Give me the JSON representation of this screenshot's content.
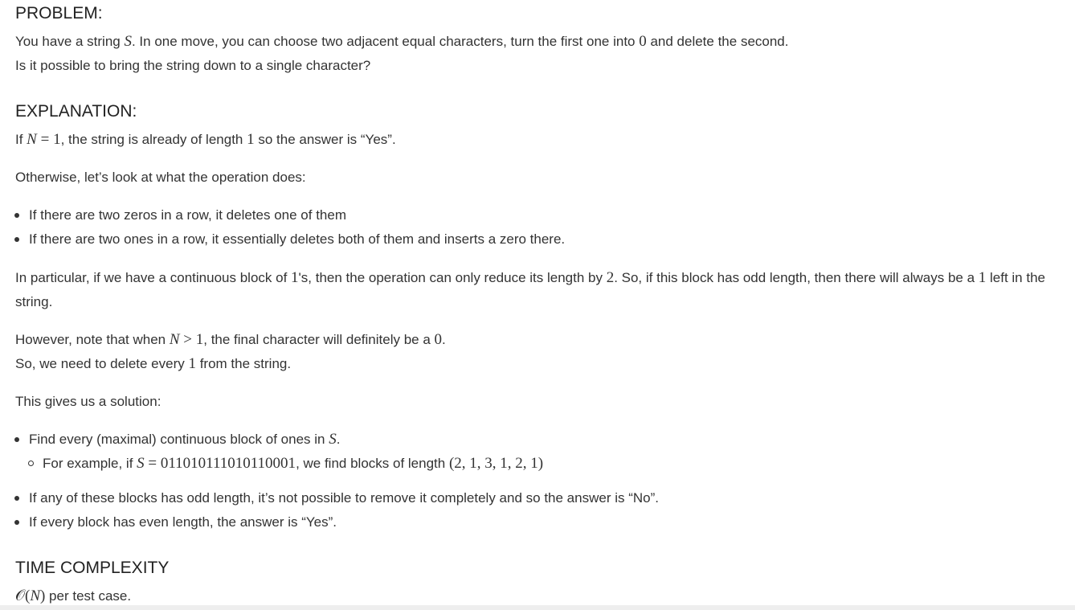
{
  "problem": {
    "heading": "PROBLEM:",
    "line1": {
      "t1": "You have a string ",
      "S": "S",
      "t2": ". In one move, you can choose two adjacent equal characters, turn the first one into ",
      "zero": "0",
      "t3": " and delete the second."
    },
    "line2": "Is it possible to bring the string down to a single character?"
  },
  "explanation": {
    "heading": "EXPLANATION:",
    "p1": {
      "t1": "If ",
      "N": "N",
      "eq": " = 1",
      "t2": ", the string is already of length ",
      "one": "1",
      "t3": " so the answer is “Yes”."
    },
    "p2": "Otherwise, let’s look at what the operation does:",
    "ops": [
      "If there are two zeros in a row, it deletes one of them",
      "If there are two ones in a row, it essentially deletes both of them and inserts a zero there."
    ],
    "p3": {
      "t1": "In particular, if we have a continuous block of ",
      "one": "1",
      "t2": "'s, then the operation can only reduce its length by ",
      "two": "2",
      "t3": ". So, if this block has odd length, then there will always be a ",
      "one2": "1",
      "t4": " left in the string."
    },
    "p4": {
      "t1": "However, note that when ",
      "N": "N",
      "gt": " > 1",
      "t2": ", the final character will definitely be a ",
      "zero": "0",
      "t3": "."
    },
    "p5": {
      "t1": "So, we need to delete every ",
      "one": "1",
      "t2": " from the string."
    },
    "p6": "This gives us a solution:",
    "sol": {
      "item1": {
        "t1": "Find every (maximal) continuous block of ones in ",
        "S": "S",
        "t2": "."
      },
      "sub1": {
        "t1": "For example, if ",
        "S": "S",
        "eq": " = 011010111010110001",
        "t2": ", we find blocks of length ",
        "tuple": "(2, 1, 3, 1, 2, 1)"
      },
      "item2": "If any of these blocks has odd length, it’s not possible to remove it completely and so the answer is “No”.",
      "item3": "If every block has even length, the answer is “Yes”."
    }
  },
  "complexity": {
    "heading": "TIME COMPLEXITY",
    "O": "𝒪",
    "paren_open": "(",
    "N": "N",
    "paren_close": ")",
    "text": " per test case."
  }
}
